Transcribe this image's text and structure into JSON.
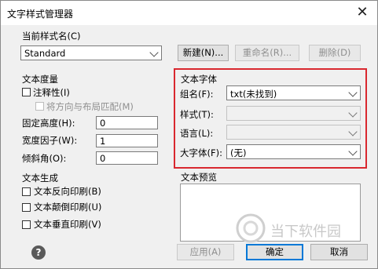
{
  "window": {
    "title": "文字样式管理器"
  },
  "current_style": {
    "label": "当前样式名(C)",
    "value": "Standard",
    "new_button": "新建(N)...",
    "rename_button": "重命名(R)...",
    "delete_button": "删除(D)"
  },
  "metrics": {
    "heading": "文本度量",
    "annotative_label": "注释性(I)",
    "match_orientation_label": "将方向与布局匹配(M)",
    "fixed_height_label": "固定高度(H):",
    "fixed_height_value": "0",
    "width_factor_label": "宽度因子(W):",
    "width_factor_value": "1",
    "oblique_angle_label": "倾斜角(O):",
    "oblique_angle_value": "0"
  },
  "font": {
    "heading": "文本字体",
    "group_name_label": "组名(F):",
    "group_name_value": "txt(未找到)",
    "style_label": "样式(T):",
    "language_label": "语言(L):",
    "bigfont_label": "大字体(F):",
    "bigfont_value": "(无)"
  },
  "generation": {
    "heading": "文本生成",
    "backwards_label": "文本反向印刷(B)",
    "upside_down_label": "文本颠倒印刷(U)",
    "vertical_label": "文本垂直印刷(V)"
  },
  "preview": {
    "heading": "文本预览"
  },
  "footer": {
    "apply_button": "应用(A)",
    "ok_button": "确定",
    "cancel_button": "取消"
  },
  "watermark": {
    "text": "当下软件园"
  },
  "colors": {
    "highlight": "#d9282f",
    "default_button_border": "#0078d7"
  },
  "icons": {
    "close": "close-icon",
    "help": "help-icon"
  }
}
